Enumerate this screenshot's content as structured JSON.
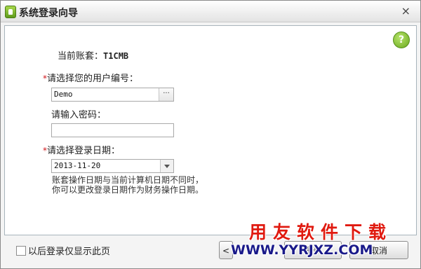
{
  "window": {
    "title": "系统登录向导",
    "close_glyph": "×",
    "help_glyph": "?"
  },
  "account": {
    "label": "当前账套：",
    "value": "T1CMB"
  },
  "user": {
    "required_mark": "*",
    "label": "请选择您的用户编号：",
    "value": "Demo",
    "browse_glyph": "···"
  },
  "password": {
    "label": "请输入密码：",
    "value": ""
  },
  "date": {
    "required_mark": "*",
    "label": "请选择登录日期：",
    "value": "2013-11-20",
    "note_line1": "账套操作日期与当前计算机日期不同时，",
    "note_line2": "你可以更改登录日期作为财务操作日期。"
  },
  "footer": {
    "skip_checkbox_label": "以后登录仅显示此页",
    "back_label": "<",
    "login_label": "登录",
    "cancel_label": "取消"
  },
  "watermark": {
    "line1": "用友软件下载",
    "line2": "WWW.YYRJXZ.COM"
  },
  "colors": {
    "required": "#d0141a",
    "watermark_red": "#e01a10",
    "watermark_blue": "#1a1a8a",
    "help_green": "#6aa81e"
  }
}
